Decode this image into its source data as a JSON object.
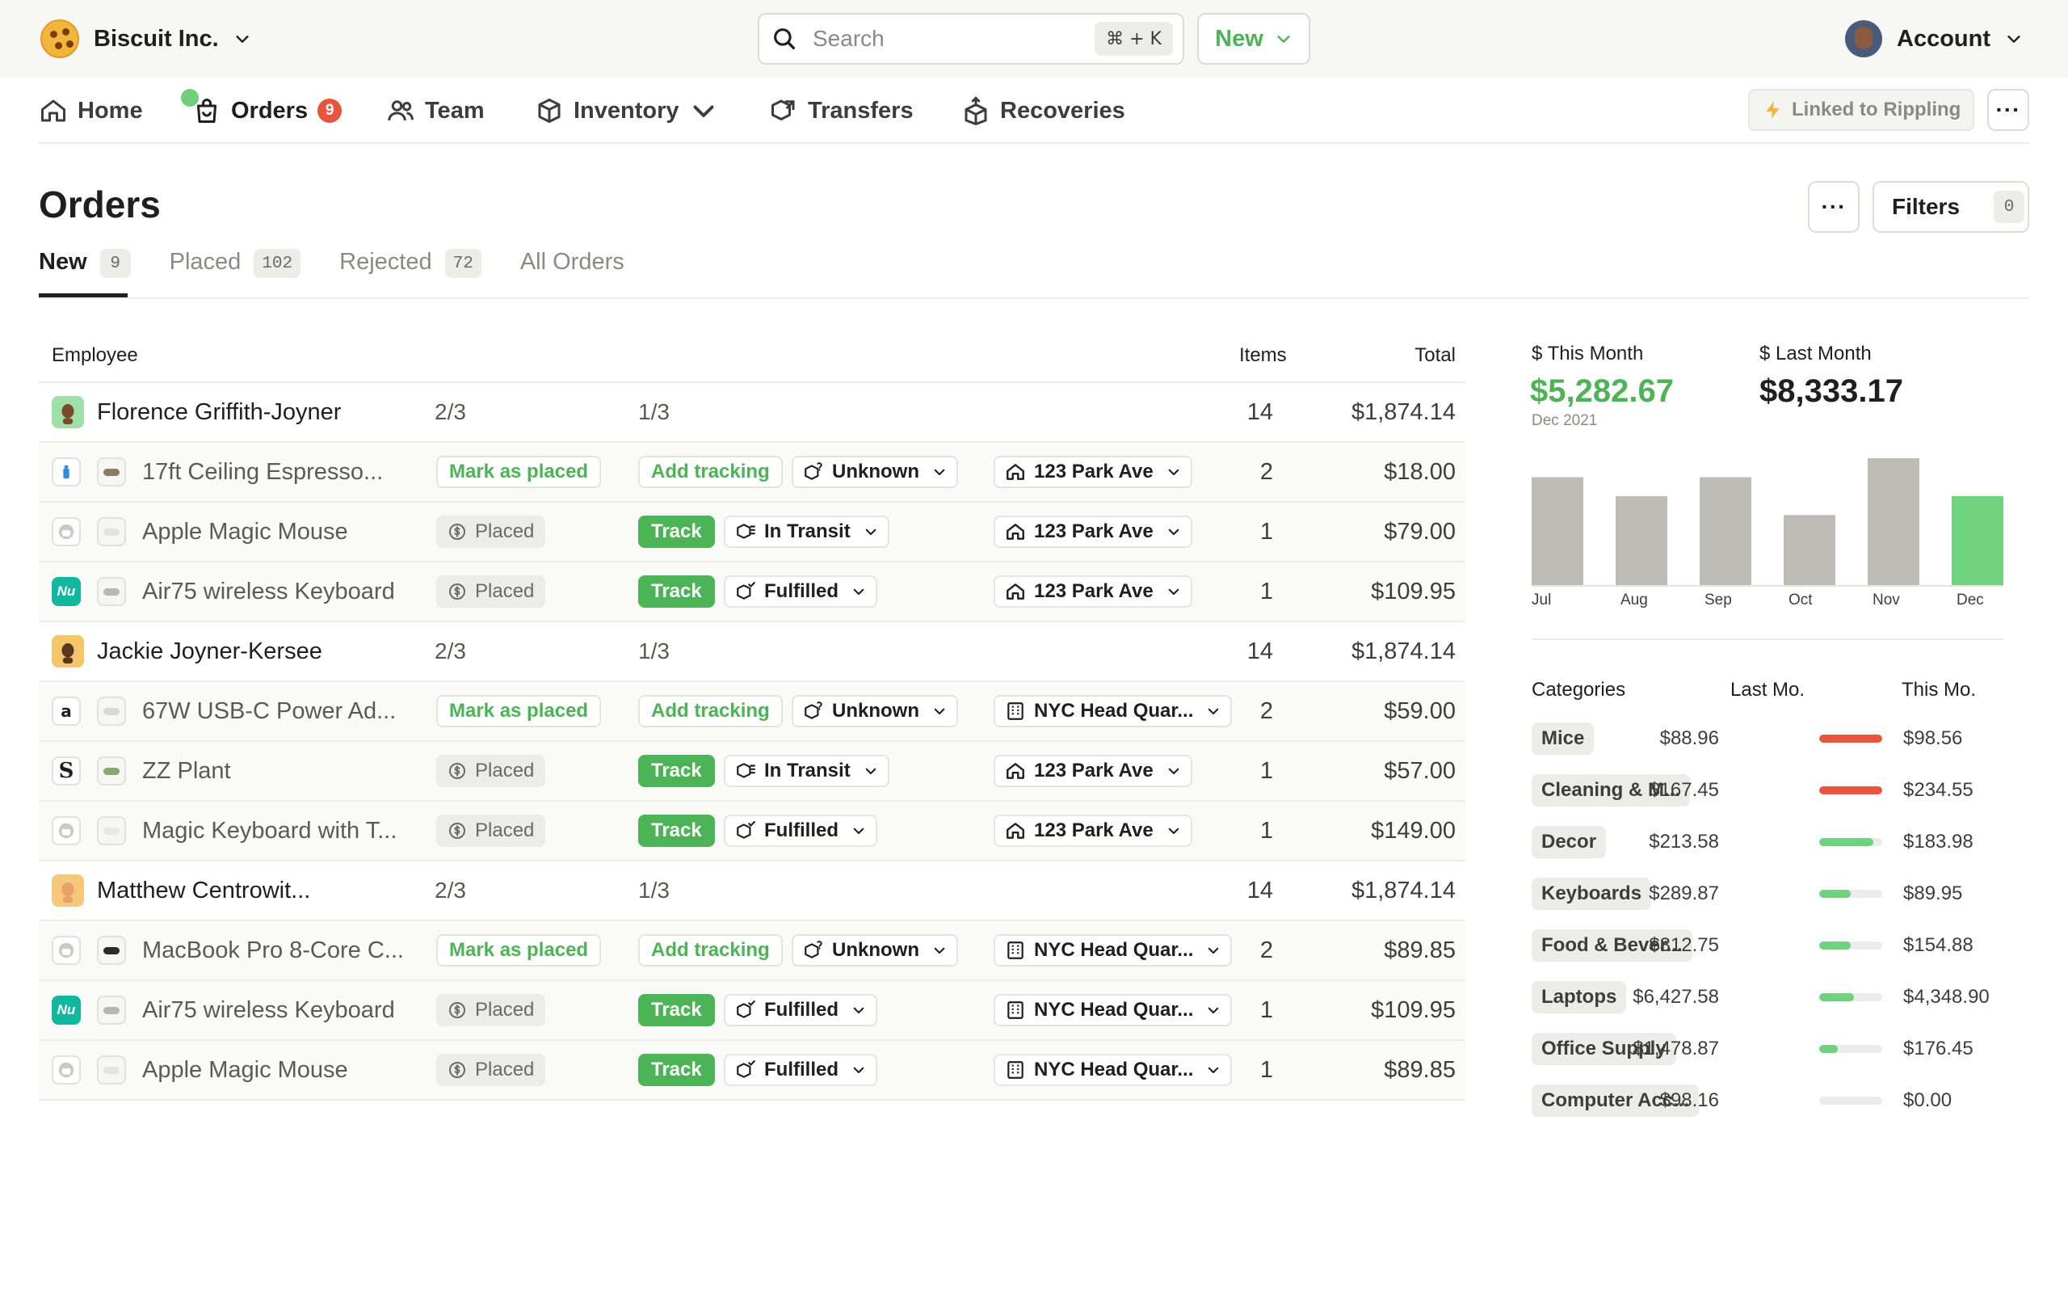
{
  "header": {
    "brand_name": "Biscuit Inc.",
    "search_placeholder": "Search",
    "search_shortcut": "⌘ + K",
    "new_label": "New",
    "account_label": "Account"
  },
  "nav": {
    "items": [
      {
        "label": "Home",
        "icon": "home-icon"
      },
      {
        "label": "Orders",
        "icon": "bag-icon",
        "badge": "9"
      },
      {
        "label": "Team",
        "icon": "team-icon"
      },
      {
        "label": "Inventory",
        "icon": "box-icon"
      },
      {
        "label": "Transfers",
        "icon": "transfer-icon"
      },
      {
        "label": "Recoveries",
        "icon": "recovery-icon"
      }
    ],
    "linked_label": "Linked to Rippling",
    "more_label": "···"
  },
  "page": {
    "title": "Orders",
    "filters_label": "Filters",
    "filters_count": "0",
    "more_label": "···",
    "tabs": [
      {
        "label": "New",
        "count": "9"
      },
      {
        "label": "Placed",
        "count": "102"
      },
      {
        "label": "Rejected",
        "count": "72"
      },
      {
        "label": "All Orders",
        "count": ""
      }
    ]
  },
  "table": {
    "headers": {
      "employee": "Employee",
      "items": "Items",
      "total": "Total"
    },
    "rows": [
      {
        "type": "employee",
        "name": "Florence Griffith-Joyner",
        "placed": "2/3",
        "tracked": "1/3",
        "items": "14",
        "total": "$1,874.14"
      },
      {
        "type": "item",
        "vendor": "bottle",
        "name": "17ft Ceiling Espresso...",
        "status": "Mark as placed",
        "tracking": "Add tracking",
        "shipping": "Unknown",
        "address": "123 Park Ave",
        "addr_icon": "home",
        "items": "2",
        "total": "$18.00"
      },
      {
        "type": "item",
        "vendor": "apple",
        "name": "Apple Magic Mouse",
        "status": "Placed",
        "tracking": "Track",
        "shipping": "In Transit",
        "address": "123 Park Ave",
        "addr_icon": "home",
        "items": "1",
        "total": "$79.00"
      },
      {
        "type": "item",
        "vendor": "nu",
        "name": "Air75 wireless Keyboard",
        "status": "Placed",
        "tracking": "Track",
        "shipping": "Fulfilled",
        "address": "123 Park Ave",
        "addr_icon": "home",
        "items": "1",
        "total": "$109.95"
      },
      {
        "type": "employee",
        "name": "Jackie Joyner-Kersee",
        "placed": "2/3",
        "tracked": "1/3",
        "items": "14",
        "total": "$1,874.14"
      },
      {
        "type": "item",
        "vendor": "amazon",
        "name": "67W USB-C Power Ad...",
        "status": "Mark as placed",
        "tracking": "Add tracking",
        "shipping": "Unknown",
        "address": "NYC Head Quar...",
        "addr_icon": "building",
        "items": "2",
        "total": "$59.00"
      },
      {
        "type": "item",
        "vendor": "s",
        "name": "ZZ Plant",
        "status": "Placed",
        "tracking": "Track",
        "shipping": "In Transit",
        "address": "123 Park Ave",
        "addr_icon": "home",
        "items": "1",
        "total": "$57.00"
      },
      {
        "type": "item",
        "vendor": "apple",
        "name": "Magic Keyboard with T...",
        "status": "Placed",
        "tracking": "Track",
        "shipping": "Fulfilled",
        "address": "123 Park Ave",
        "addr_icon": "home",
        "items": "1",
        "total": "$149.00"
      },
      {
        "type": "employee",
        "name": "Matthew Centrowit...",
        "placed": "2/3",
        "tracked": "1/3",
        "items": "14",
        "total": "$1,874.14"
      },
      {
        "type": "item",
        "vendor": "apple",
        "name": "MacBook Pro 8-Core C...",
        "status": "Mark as placed",
        "tracking": "Add tracking",
        "shipping": "Unknown",
        "address": "NYC Head Quar...",
        "addr_icon": "building",
        "items": "2",
        "total": "$89.85"
      },
      {
        "type": "item",
        "vendor": "nu",
        "name": "Air75 wireless Keyboard",
        "status": "Placed",
        "tracking": "Track",
        "shipping": "Fulfilled",
        "address": "NYC Head Quar...",
        "addr_icon": "building",
        "items": "1",
        "total": "$109.95"
      },
      {
        "type": "item",
        "vendor": "apple",
        "name": "Apple Magic Mouse",
        "status": "Placed",
        "tracking": "Track",
        "shipping": "Fulfilled",
        "address": "NYC Head Quar...",
        "addr_icon": "building",
        "items": "1",
        "total": "$89.85"
      }
    ]
  },
  "summary": {
    "this_month_label": "$ This Month",
    "this_month_value": "$5,282.67",
    "this_month_sub": "Dec 2021",
    "last_month_label": "$ Last Month",
    "last_month_value": "$8,333.17"
  },
  "chart_data": {
    "type": "bar",
    "categories": [
      "Jul",
      "Aug",
      "Sep",
      "Oct",
      "Nov",
      "Dec"
    ],
    "values": [
      5700,
      4700,
      5700,
      3700,
      6700,
      4700
    ],
    "highlight_index": 5,
    "ylim": [
      0,
      7000
    ],
    "grid": false,
    "colors": {
      "default": "#bdbdb6",
      "highlight": "#6fd27c"
    }
  },
  "categories": {
    "headers": {
      "name": "Categories",
      "last": "Last Mo.",
      "this": "This Mo."
    },
    "rows": [
      {
        "name": "Mice",
        "last": "$88.96",
        "this": "$98.56",
        "bar": 1.0,
        "color": "#e8543c"
      },
      {
        "name": "Cleaning & M...",
        "last": "$167.45",
        "this": "$234.55",
        "bar": 1.0,
        "color": "#e8543c"
      },
      {
        "name": "Decor",
        "last": "$213.58",
        "this": "$183.98",
        "bar": 0.86,
        "color": "#6fd27c"
      },
      {
        "name": "Keyboards",
        "last": "$289.87",
        "this": "$89.95",
        "bar": 0.5,
        "color": "#6fd27c"
      },
      {
        "name": "Food & Bever...",
        "last": "$312.75",
        "this": "$154.88",
        "bar": 0.5,
        "color": "#6fd27c"
      },
      {
        "name": "Laptops",
        "last": "$6,427.58",
        "this": "$4,348.90",
        "bar": 0.55,
        "color": "#6fd27c"
      },
      {
        "name": "Office Supply",
        "last": "$1,478.87",
        "this": "$176.45",
        "bar": 0.3,
        "color": "#6fd27c"
      },
      {
        "name": "Computer Acc...",
        "last": "$98.16",
        "this": "$0.00",
        "bar": 0.0,
        "color": "#6fd27c"
      }
    ]
  }
}
